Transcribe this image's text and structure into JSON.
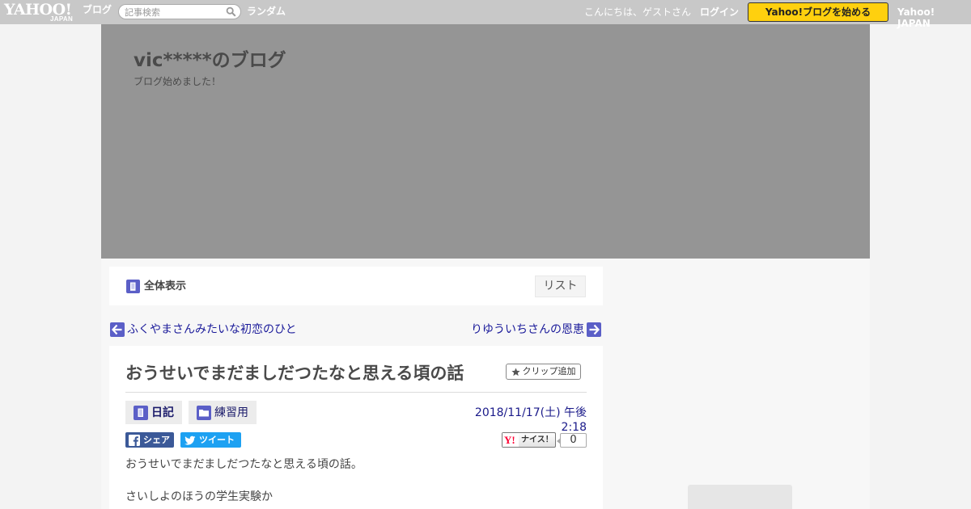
{
  "topbar": {
    "logo_main": "YAHOO!",
    "logo_sub": "JAPAN",
    "blog_label": "ブログ",
    "search_placeholder": "記事検索",
    "random_label": "ランダム",
    "greeting": "こんにちは、ゲストさん",
    "login_label": "ログイン",
    "start_blog_label": "Yahoo!ブログを始める",
    "yahoo_japan_label": "Yahoo! JAPAN"
  },
  "header": {
    "blog_title": "vic*****のブログ",
    "blog_description": "ブログ始めました！"
  },
  "toolbar": {
    "all_view_label": "全体表示",
    "list_label": "リスト"
  },
  "navigation": {
    "prev_label": "ふくやまさんみたいな初恋のひと",
    "next_label": "りゆういちさんの恩恵"
  },
  "article": {
    "title": "おうせいでまだましだつたなと思える頃の話",
    "clip_label": "クリップ追加",
    "categories": [
      {
        "label": "日記"
      },
      {
        "label": "練習用"
      }
    ],
    "date": "2018/11/17(土) 午後 2:18",
    "share": {
      "facebook_label": "シェア",
      "twitter_label": "ツイート"
    },
    "nice_label": "ナイス！",
    "nice_count": "0",
    "body": [
      "おうせいでまだましだつたなと思える頃の話。",
      "さいしよのほうの学生実験か"
    ]
  },
  "colors": {
    "topbar_bg": "#c8c8c8",
    "header_bg": "#959595",
    "start_button": "#ffd00e",
    "link": "#1a1a9a",
    "icon_purple": "#5b5fc7",
    "facebook": "#3b5998",
    "twitter": "#1da1f2"
  },
  "icons": {
    "search": "search-icon",
    "all_view": "book-icon",
    "prev": "arrow-left-icon",
    "next": "arrow-right-icon",
    "clip": "star-icon",
    "diary": "book-icon",
    "folder": "folder-icon",
    "facebook": "facebook-icon",
    "twitter": "twitter-icon",
    "nice": "yahoo-y-icon"
  }
}
